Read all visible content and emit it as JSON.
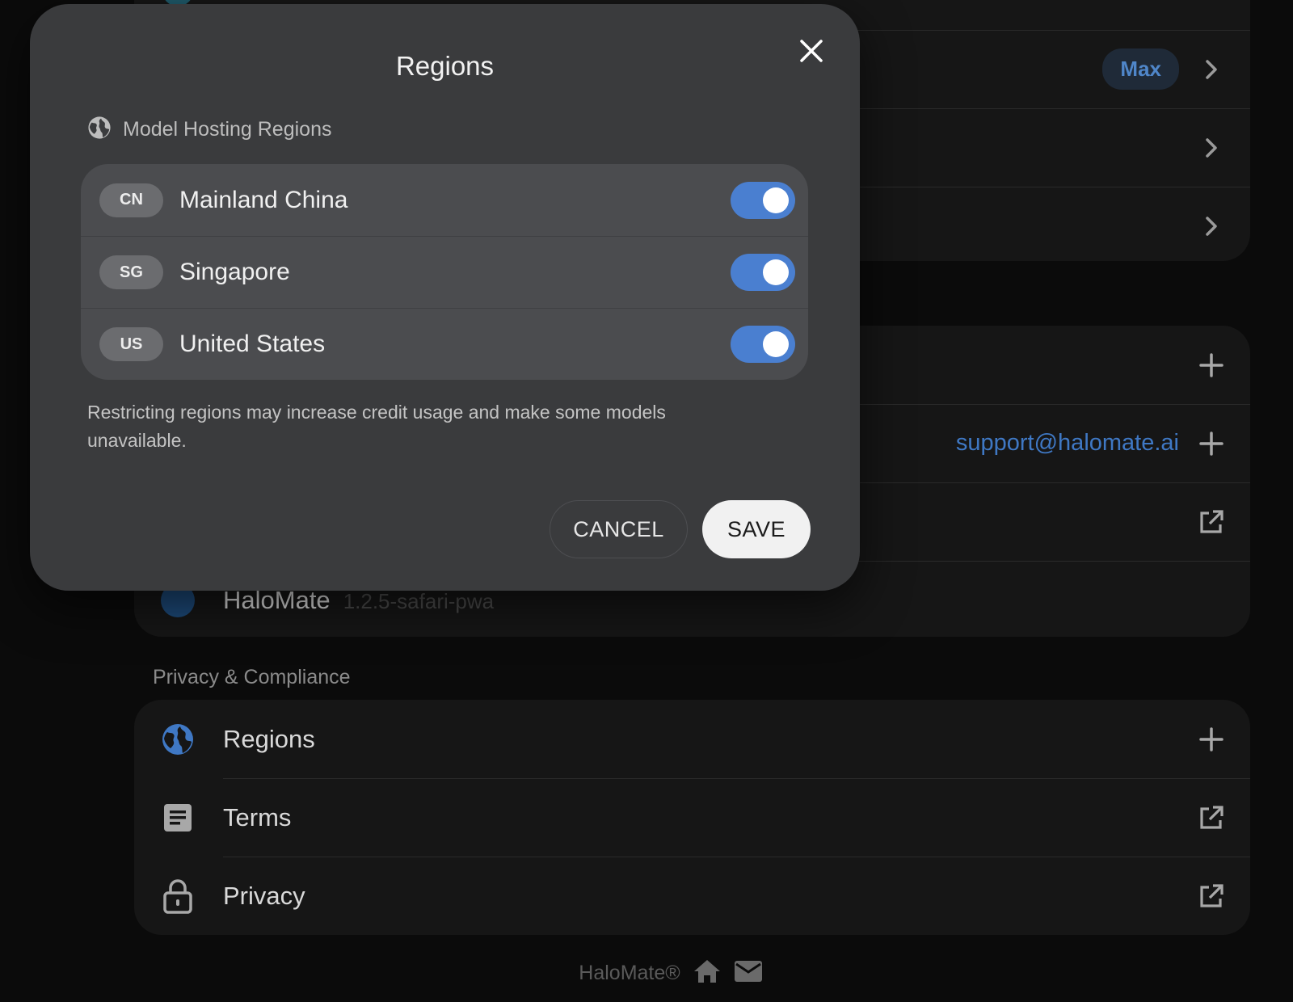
{
  "background": {
    "top_card": {
      "rows": [
        {
          "badge": "Max"
        },
        {},
        {}
      ]
    },
    "support_card": {
      "rows": [
        {},
        {
          "link": "support@halomate.ai"
        },
        {},
        {
          "label": "HaloMate",
          "version": "1.2.5-safari-pwa"
        }
      ]
    },
    "privacy_section": {
      "label": "Privacy & Compliance",
      "rows": [
        {
          "label": "Regions",
          "icon": "globe-icon",
          "trail": "plus-icon"
        },
        {
          "label": "Terms",
          "icon": "document-icon",
          "trail": "external-link-icon"
        },
        {
          "label": "Privacy",
          "icon": "lock-icon",
          "trail": "external-link-icon"
        }
      ]
    },
    "footer": {
      "brand": "HaloMate®"
    }
  },
  "modal": {
    "title": "Regions",
    "section_label": "Model Hosting Regions",
    "regions": [
      {
        "code": "CN",
        "name": "Mainland China",
        "enabled": true
      },
      {
        "code": "SG",
        "name": "Singapore",
        "enabled": true
      },
      {
        "code": "US",
        "name": "United States",
        "enabled": true
      }
    ],
    "note": "Restricting regions may increase credit usage and make some models unavailable.",
    "cancel_label": "CANCEL",
    "save_label": "SAVE"
  },
  "colors": {
    "accent": "#4a7fd0",
    "modal_bg": "#3a3b3d",
    "page_bg": "#0b0b0b",
    "link": "#3f78c4"
  }
}
